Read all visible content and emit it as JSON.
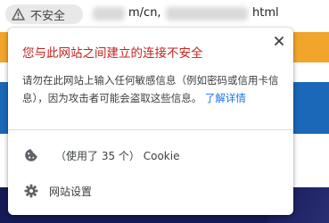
{
  "address_bar": {
    "security_label": "不安全",
    "url_middle": "m/cn,",
    "url_end": "html"
  },
  "popup": {
    "title": "您与此网站之间建立的连接不安全",
    "description": "请勿在此网站上输入任何敏感信息（例如密码或信用卡信息），因为攻击者可能会盗取这些信息。",
    "learn_more": "了解详情",
    "cookies_prefix": "（使用了 35 个）",
    "cookies_label": "Cookie",
    "site_settings": "网站设置"
  },
  "colors": {
    "warning_title": "#c5221f",
    "link": "#1a73e8",
    "page_yellow": "#f2a52b",
    "page_blue": "#1b67b8",
    "page_navy": "#141b57"
  },
  "icons": {
    "security": "warning-triangle-icon",
    "close": "close-icon",
    "cookies": "cookie-icon",
    "settings": "gear-icon"
  }
}
